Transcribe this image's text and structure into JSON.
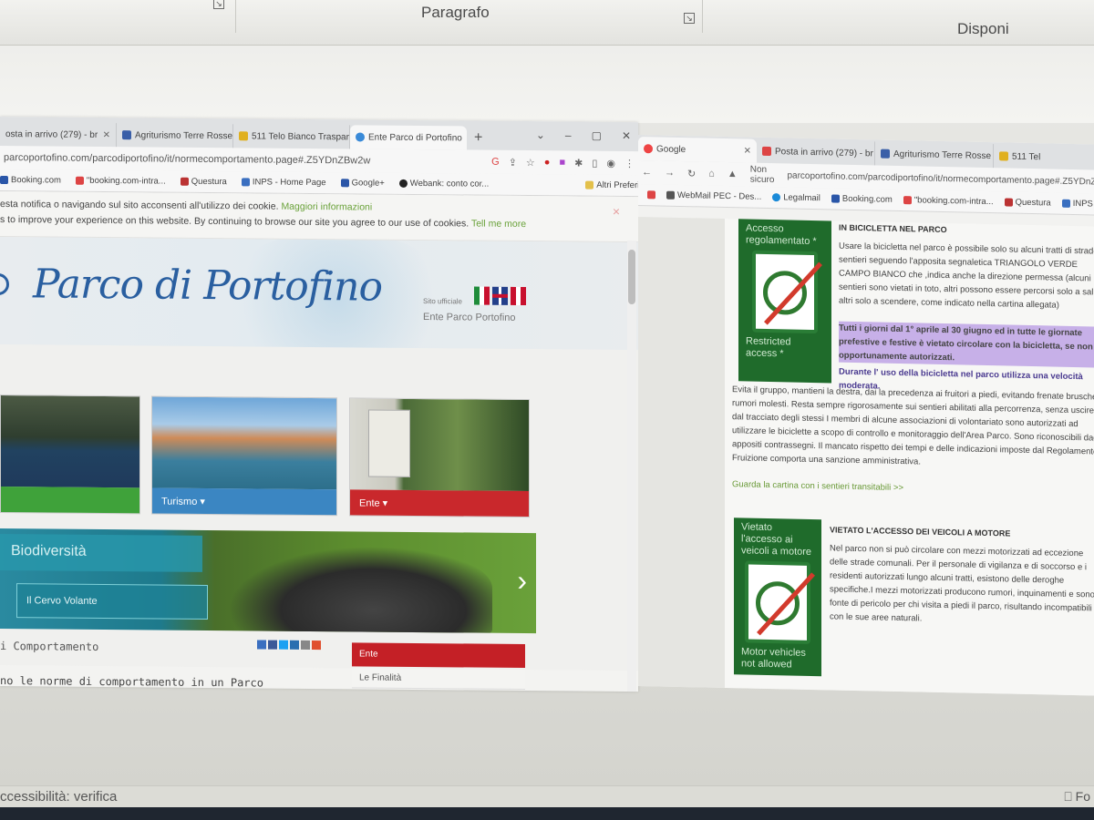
{
  "word": {
    "ribbon_group_paragraph": "Paragrafo",
    "ribbon_group_arrange": "Disponi",
    "status_left": "ccessibilità: verifica",
    "status_right": "Fo"
  },
  "left_browser": {
    "tabs": [
      {
        "label": "osta in arrivo (279) - br"
      },
      {
        "label": "Agriturismo Terre Rosse |"
      },
      {
        "label": "511 Telo Bianco Traspare"
      },
      {
        "label": "Ente Parco di Portofino"
      }
    ],
    "url": "parcoportofino.com/parcodiportofino/it/normecomportamento.page#.Z5YDnZBw2w",
    "bookmarks": [
      "Booking.com",
      "\"booking.com-intra...",
      "Questura",
      "INPS - Home Page",
      "Google+",
      "Webank: conto cor..."
    ],
    "bookmarks_other": "Altri Preferiti",
    "cookie_it": "esta notifica o navigando sul sito acconsenti all'utilizzo dei cookie.",
    "cookie_it_link": "Maggiori informazioni",
    "cookie_en": "s to improve your experience on this website. By continuing to browse our site you agree to our use of cookies.",
    "cookie_en_link": "Tell me more",
    "cookie_close": "×",
    "logo": "Parco di Portofino",
    "sito_ufficiale": "Sito ufficiale",
    "ente_label": "Ente Parco Portofino",
    "tiles": [
      {
        "caption": ""
      },
      {
        "caption": "Turismo ▾"
      },
      {
        "caption": "Ente ▾"
      }
    ],
    "slider_title": "Biodiversità",
    "slider_sub": "Il Cervo Volante",
    "slider_next": "›",
    "comportamento_title": "i Comportamento",
    "norme": "no le norme di comportamento in un Parco",
    "menu": [
      "Ente",
      "Le Finalità"
    ]
  },
  "right_browser": {
    "tabs": [
      {
        "label": "Google"
      },
      {
        "label": "Posta in arrivo (279) - br"
      },
      {
        "label": "Agriturismo Terre Rosse"
      },
      {
        "label": "511 Tel"
      }
    ],
    "not_secure": "Non sicuro",
    "url": "parcoportofino.com/parcodiportofino/it/normecomportamento.page#.Z5YDnZBw2w",
    "bookmarks": [
      "WebMail PEC - Des...",
      "Legalmail",
      "Booking.com",
      "\"booking.com-intra...",
      "Questura",
      "INPS - Home Page"
    ],
    "sign1_top": "Accesso regolamentato *",
    "sign1_bottom": "Restricted access *",
    "section1_title": "IN BICICLETTA NEL PARCO",
    "section1_p1": "Usare la bicicletta nel parco è possibile solo su alcuni tratti di strade sentieri seguendo l'apposita segnaletica TRIANGOLO VERDE CAMPO BIANCO che ,indica anche la direzione permessa (alcuni sentieri sono vietati in toto, altri possono essere percorsi solo a salire altri solo a scendere, come indicato nella cartina allegata)",
    "section1_highlight": "Tutti i giorni dal 1° aprile al 30 giugno ed in tutte le giornate prefestive e festive è vietato circolare con la bicicletta, se non opportunamente autorizzati.",
    "section1_p2": "Durante l' uso della bicicletta nel parco utilizza una velocità moderata.",
    "section1_p3": "Evita il gruppo, mantieni la destra, dai la precedenza ai fruitori a piedi, evitando frenate brusche e rumori molesti. Resta sempre rigorosamente sui sentieri abilitati alla percorrenza, senza uscire dal tracciato degli stessi I membri di alcune associazioni di volontariato sono autorizzati ad utilizzare le biciclette a scopo di controllo e monitoraggio dell'Area Parco. Sono riconoscibili dagli appositi contrassegni. Il mancato rispetto dei tempi e delle indicazioni imposte dal Regolamento di Fruizione comporta una sanzione amministrativa.",
    "section1_link": "Guarda la cartina con i sentieri transitabili >>",
    "sign2_top": "Vietato l'accesso ai veicoli a motore",
    "sign2_bottom": "Motor vehicles not allowed",
    "section2_title": "VIETATO L'ACCESSO DEI VEICOLI A MOTORE",
    "section2_p": "Nel parco non si può circolare con mezzi motorizzati ad eccezione delle strade comunali. Per il personale di vigilanza e di soccorso e i residenti autorizzati lungo alcuni tratti, esistono delle deroghe specifiche.I mezzi motorizzati producono rumori, inquinamenti e sono fonte di pericolo per chi visita a piedi il parco, risultando incompatibili con le sue aree naturali."
  },
  "colors": {
    "green_sign": "#1f6b2b",
    "red_menu": "#c42026",
    "logo_blue": "#2a5fa0",
    "highlight": "#c7b0e8"
  }
}
